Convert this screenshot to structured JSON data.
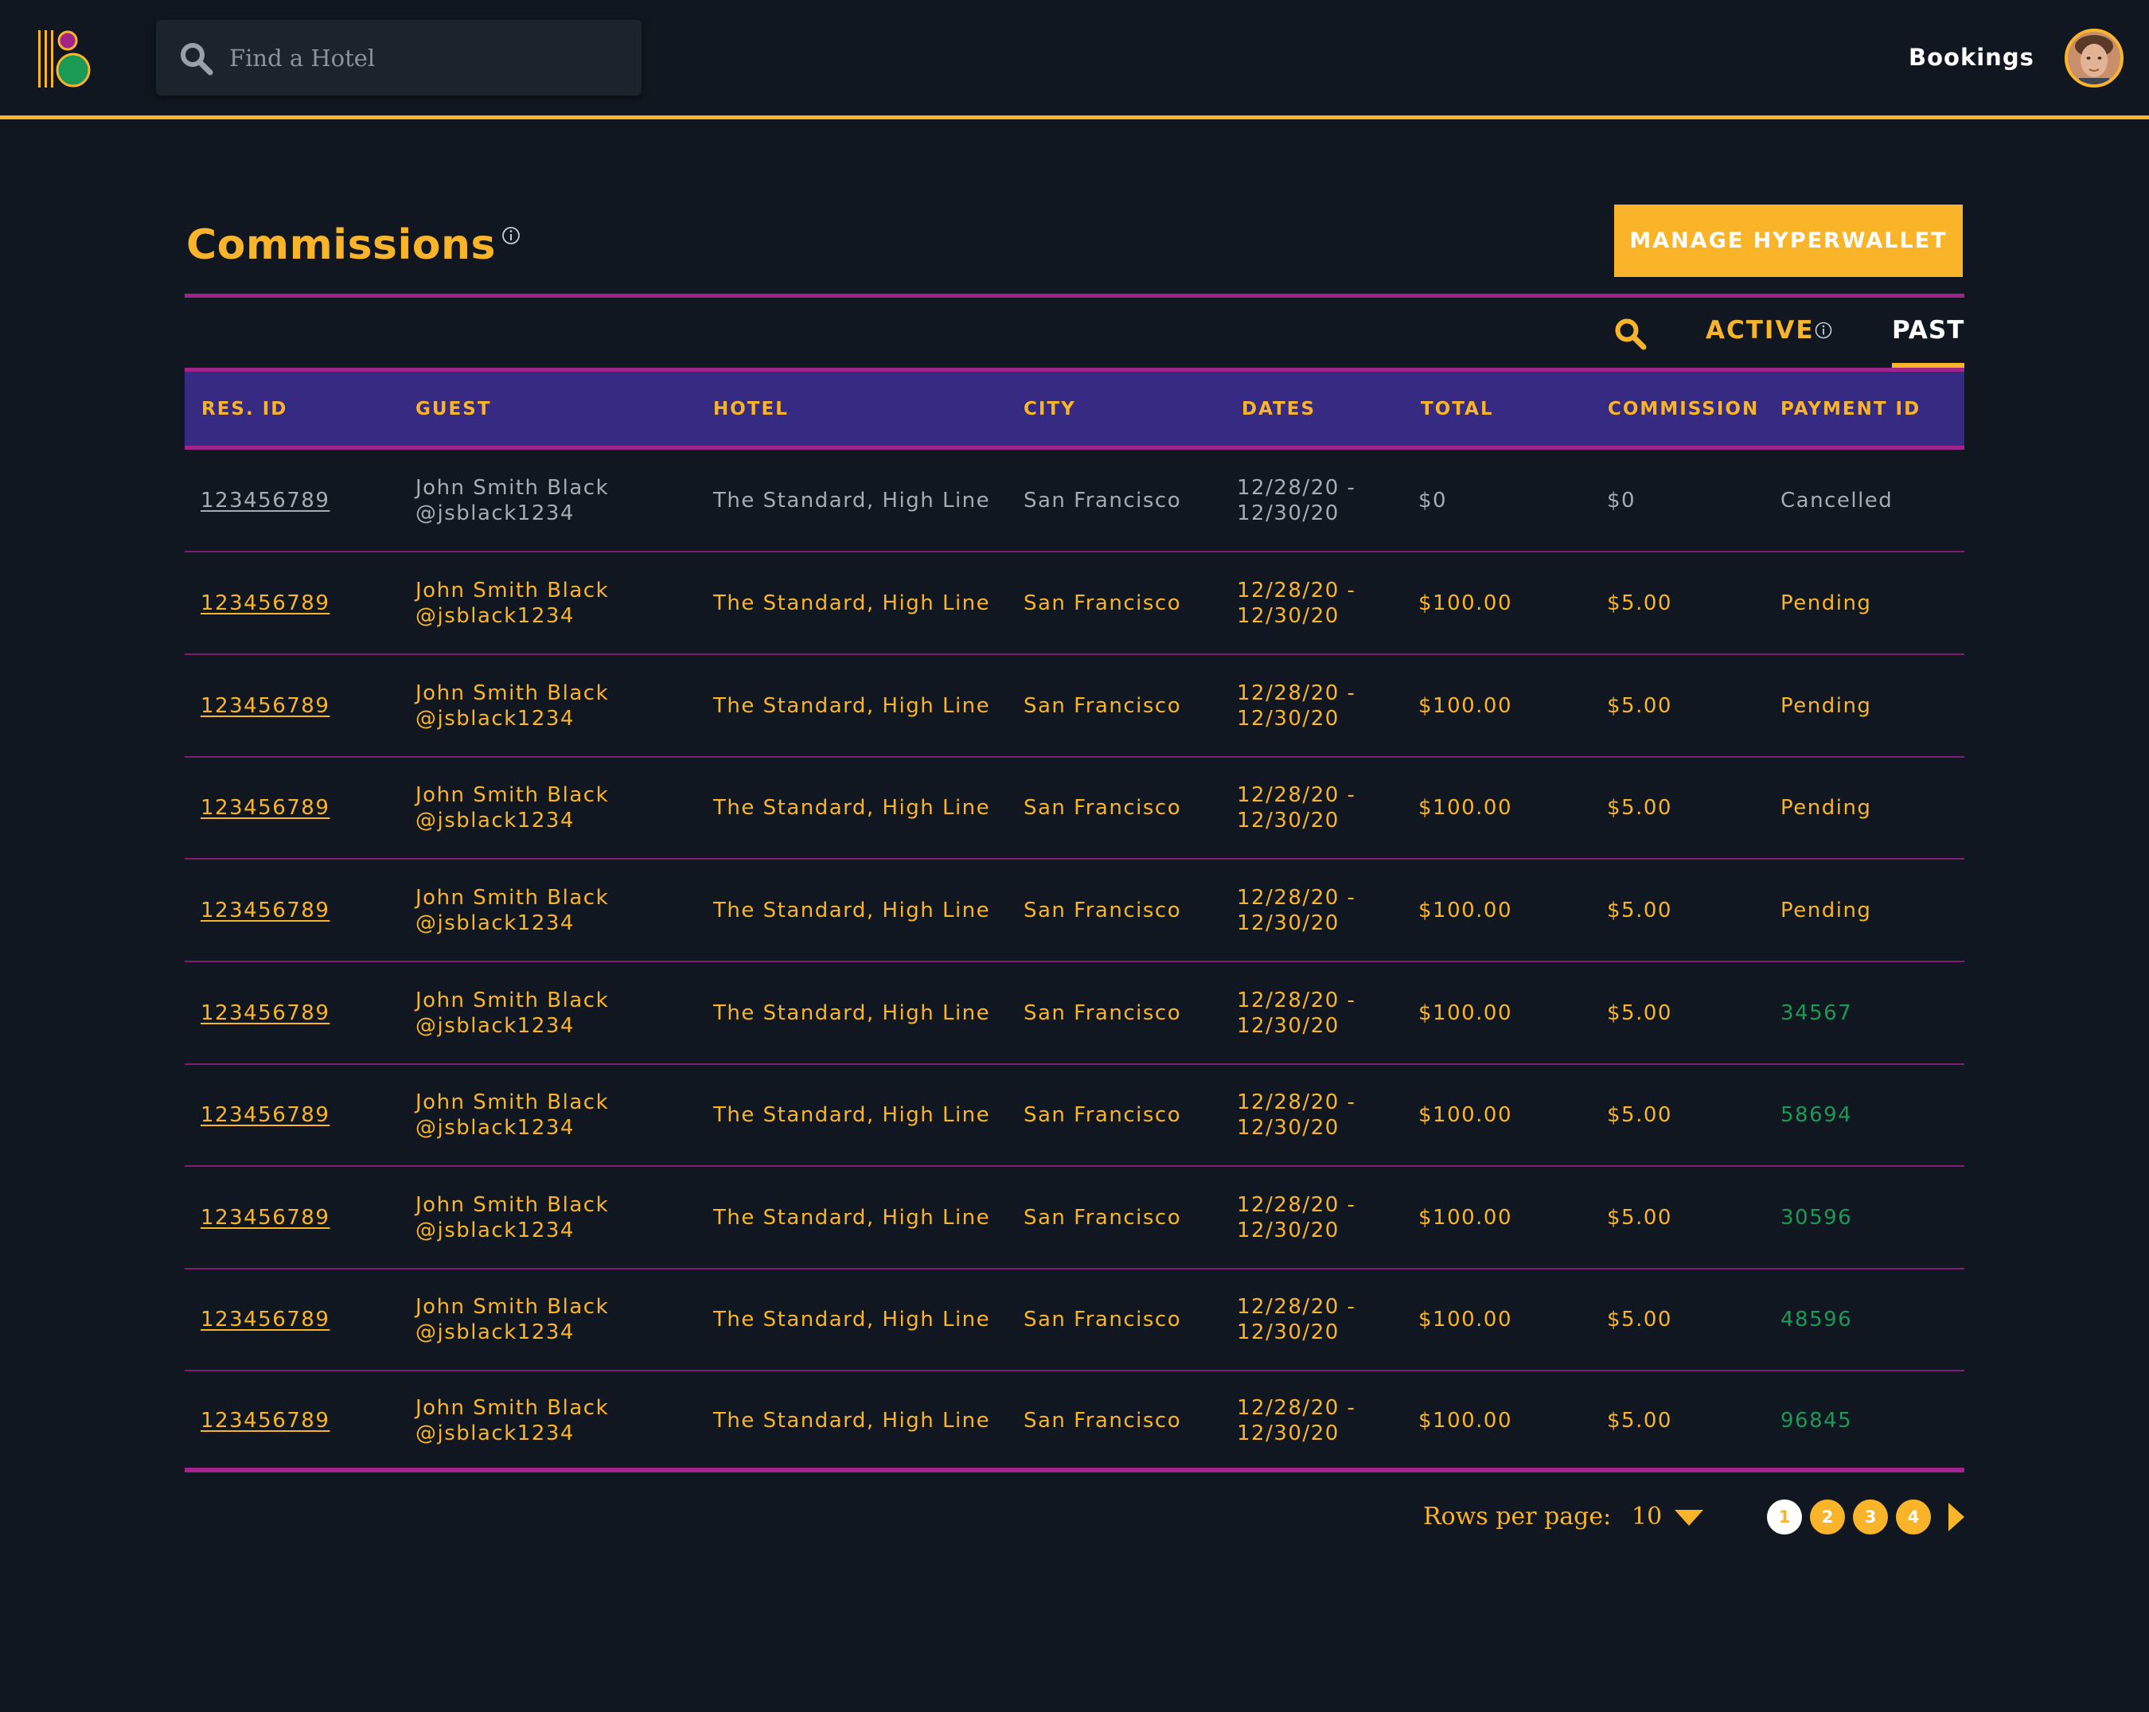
{
  "header": {
    "search_placeholder": "Find a Hotel",
    "nav_bookings": "Bookings"
  },
  "page": {
    "title": "Commissions",
    "manage_button": "MANAGE HYPERWALLET"
  },
  "tabs": {
    "active": "ACTIVE",
    "past": "PAST",
    "selected": "PAST"
  },
  "table": {
    "columns": [
      "RES. ID",
      "GUEST",
      "HOTEL",
      "CITY",
      "DATES",
      "TOTAL",
      "COMMISSION",
      "PAYMENT ID"
    ],
    "rows": [
      {
        "res_id": "123456789",
        "guest_name": "John Smith Black",
        "guest_handle": "@jsblack1234",
        "hotel": "The Standard, High Line",
        "city": "San Francisco",
        "date_start": "12/28/20 -",
        "date_end": "12/30/20",
        "total": "$0",
        "commission": "$0",
        "payment_id": "Cancelled",
        "status": "cancelled"
      },
      {
        "res_id": "123456789",
        "guest_name": "John Smith Black",
        "guest_handle": "@jsblack1234",
        "hotel": "The Standard, High Line",
        "city": "San Francisco",
        "date_start": "12/28/20 -",
        "date_end": "12/30/20",
        "total": "$100.00",
        "commission": "$5.00",
        "payment_id": "Pending",
        "status": "pending"
      },
      {
        "res_id": "123456789",
        "guest_name": "John Smith Black",
        "guest_handle": "@jsblack1234",
        "hotel": "The Standard, High Line",
        "city": "San Francisco",
        "date_start": "12/28/20 -",
        "date_end": "12/30/20",
        "total": "$100.00",
        "commission": "$5.00",
        "payment_id": "Pending",
        "status": "pending"
      },
      {
        "res_id": "123456789",
        "guest_name": "John Smith Black",
        "guest_handle": "@jsblack1234",
        "hotel": "The Standard, High Line",
        "city": "San Francisco",
        "date_start": "12/28/20 -",
        "date_end": "12/30/20",
        "total": "$100.00",
        "commission": "$5.00",
        "payment_id": "Pending",
        "status": "pending"
      },
      {
        "res_id": "123456789",
        "guest_name": "John Smith Black",
        "guest_handle": "@jsblack1234",
        "hotel": "The Standard, High Line",
        "city": "San Francisco",
        "date_start": "12/28/20 -",
        "date_end": "12/30/20",
        "total": "$100.00",
        "commission": "$5.00",
        "payment_id": "Pending",
        "status": "pending"
      },
      {
        "res_id": "123456789",
        "guest_name": "John Smith Black",
        "guest_handle": "@jsblack1234",
        "hotel": "The Standard, High Line",
        "city": "San Francisco",
        "date_start": "12/28/20 -",
        "date_end": "12/30/20",
        "total": "$100.00",
        "commission": "$5.00",
        "payment_id": "34567",
        "status": "paid"
      },
      {
        "res_id": "123456789",
        "guest_name": "John Smith Black",
        "guest_handle": "@jsblack1234",
        "hotel": "The Standard, High Line",
        "city": "San Francisco",
        "date_start": "12/28/20 -",
        "date_end": "12/30/20",
        "total": "$100.00",
        "commission": "$5.00",
        "payment_id": "58694",
        "status": "paid"
      },
      {
        "res_id": "123456789",
        "guest_name": "John Smith Black",
        "guest_handle": "@jsblack1234",
        "hotel": "The Standard, High Line",
        "city": "San Francisco",
        "date_start": "12/28/20 -",
        "date_end": "12/30/20",
        "total": "$100.00",
        "commission": "$5.00",
        "payment_id": "30596",
        "status": "paid"
      },
      {
        "res_id": "123456789",
        "guest_name": "John Smith Black",
        "guest_handle": "@jsblack1234",
        "hotel": "The Standard, High Line",
        "city": "San Francisco",
        "date_start": "12/28/20 -",
        "date_end": "12/30/20",
        "total": "$100.00",
        "commission": "$5.00",
        "payment_id": "48596",
        "status": "paid"
      },
      {
        "res_id": "123456789",
        "guest_name": "John Smith Black",
        "guest_handle": "@jsblack1234",
        "hotel": "The Standard, High Line",
        "city": "San Francisco",
        "date_start": "12/28/20 -",
        "date_end": "12/30/20",
        "total": "$100.00",
        "commission": "$5.00",
        "payment_id": "96845",
        "status": "paid"
      }
    ]
  },
  "pagination": {
    "rows_per_page_label": "Rows per page:",
    "rows_per_page_value": "10",
    "pages": [
      "1",
      "2",
      "3",
      "4"
    ],
    "current_page": "1"
  },
  "icons": {
    "search": "search-icon",
    "info": "info-icon",
    "caret": "caret-down-icon",
    "next": "chevron-right-icon"
  },
  "colors": {
    "background": "#101720",
    "accent": "#f9b42a",
    "header_row": "#372a82",
    "divider": "#a1248b",
    "paid": "#1a9a55",
    "muted": "#a7abb2"
  }
}
